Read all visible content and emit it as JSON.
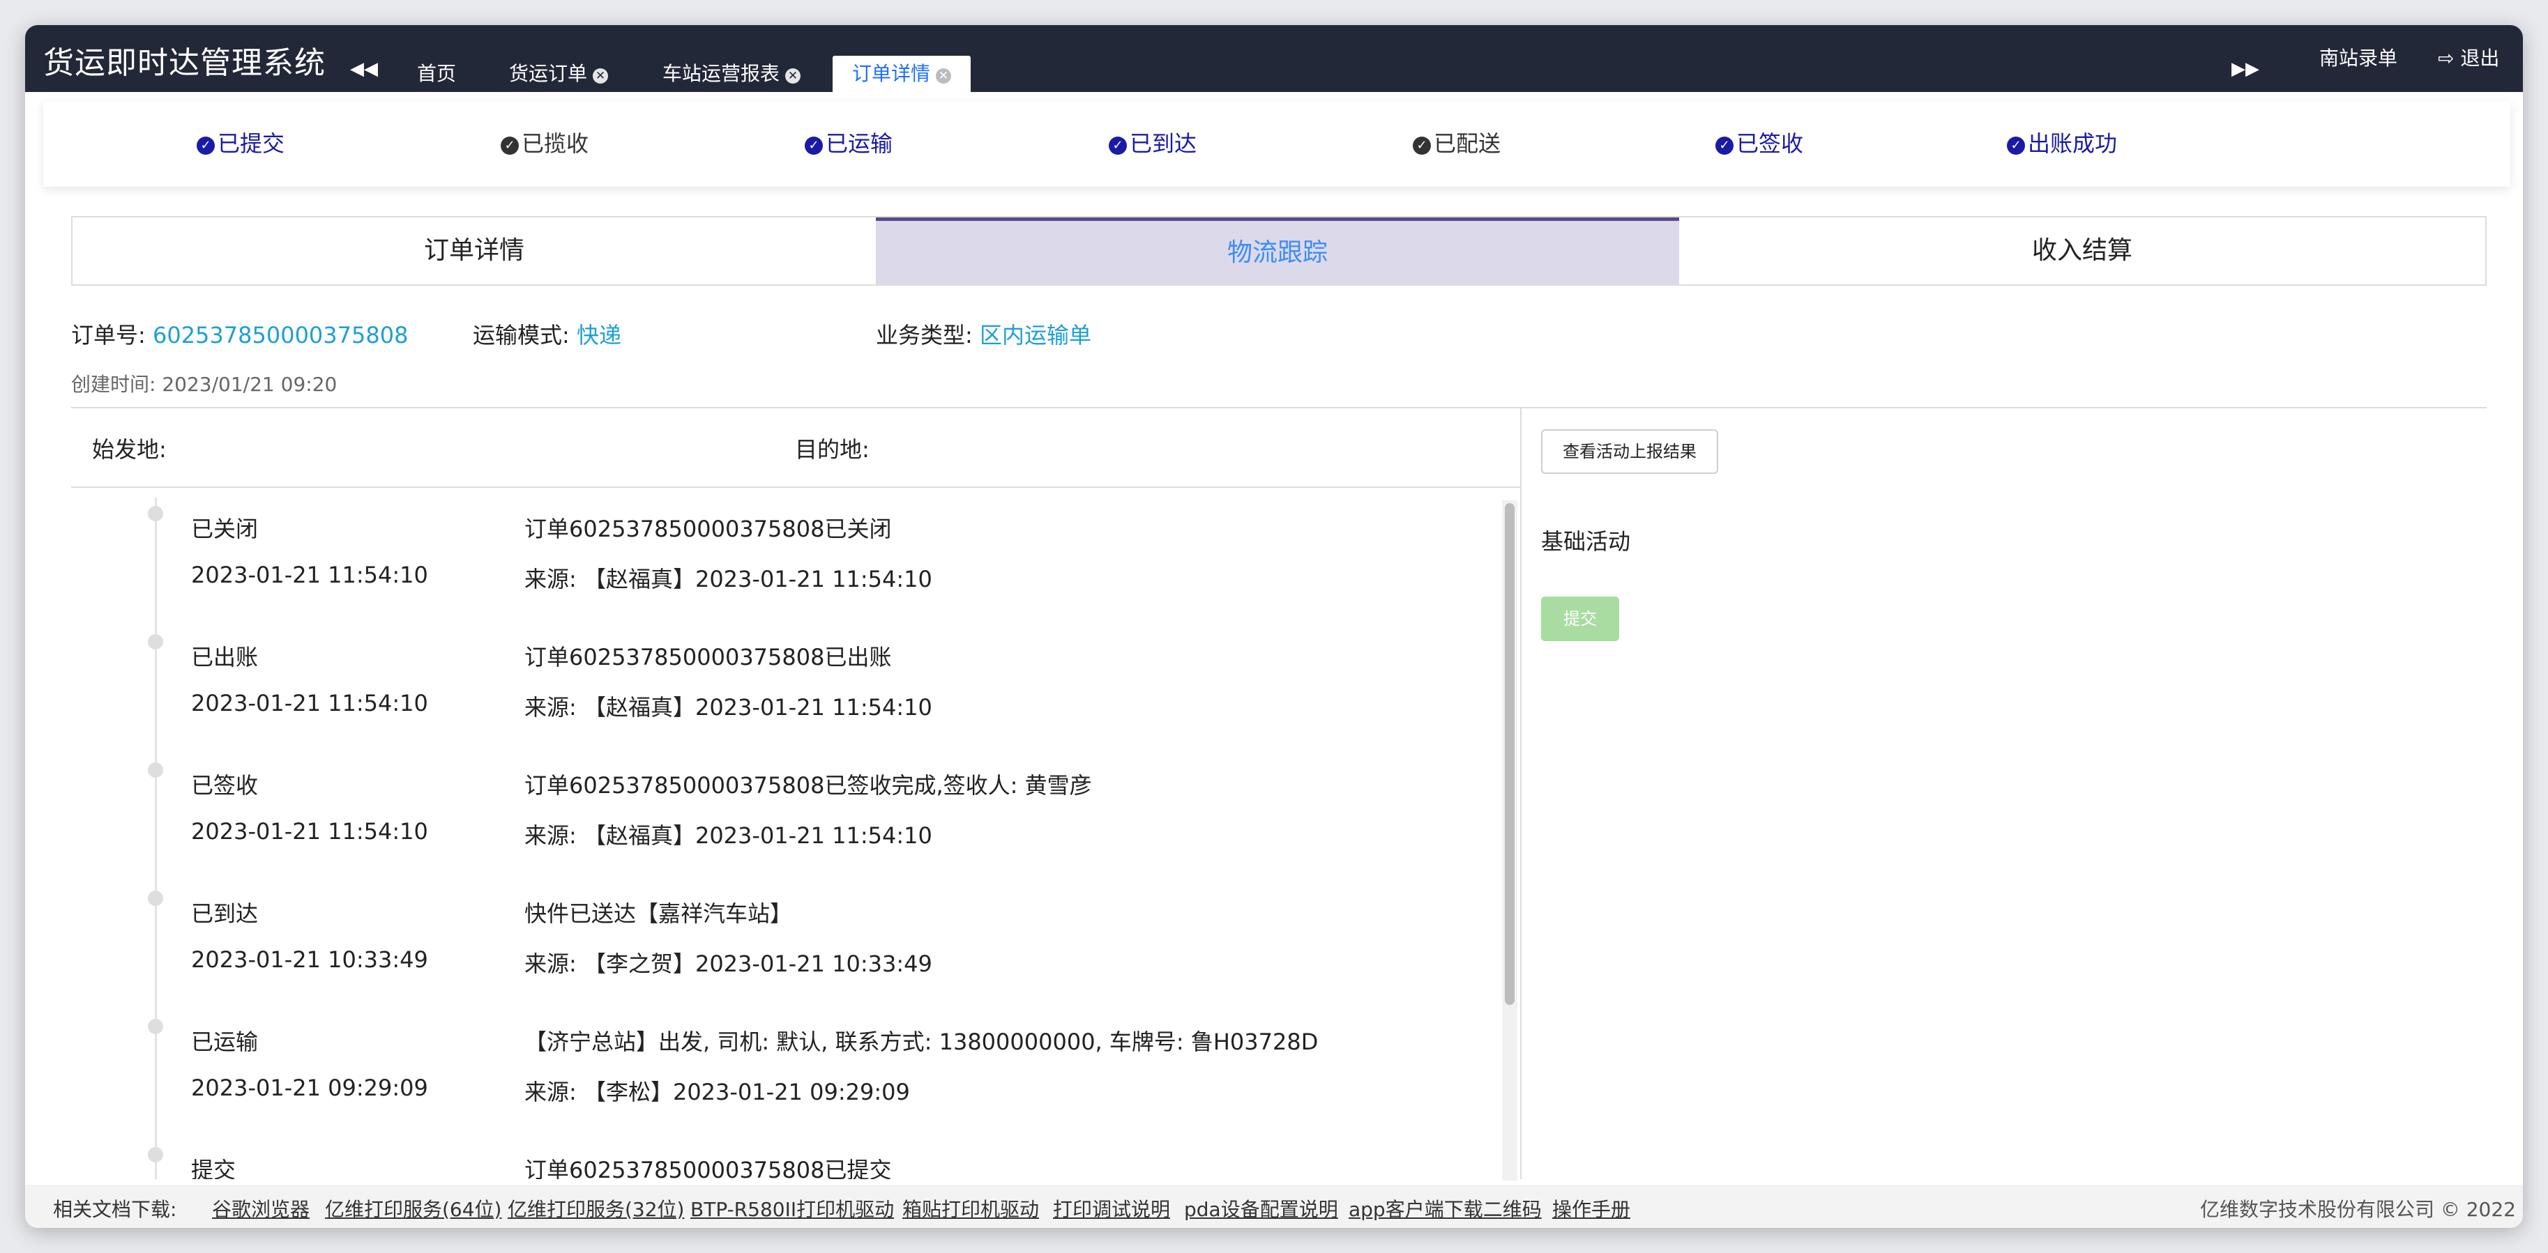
{
  "app": {
    "title": "货运即时达管理系统"
  },
  "nav": {
    "tabs": [
      {
        "label": "首页"
      },
      {
        "label": "货运订单"
      },
      {
        "label": "车站运营报表"
      },
      {
        "label": "订单详情"
      }
    ],
    "station": "南站录单",
    "logout": "退出"
  },
  "statuses": [
    {
      "label": "已提交",
      "state": "done"
    },
    {
      "label": "已揽收",
      "state": "pending"
    },
    {
      "label": "已运输",
      "state": "done"
    },
    {
      "label": "已到达",
      "state": "done"
    },
    {
      "label": "已配送",
      "state": "pending"
    },
    {
      "label": "已签收",
      "state": "done"
    },
    {
      "label": "出账成功",
      "state": "done"
    }
  ],
  "main_tabs": [
    {
      "label": "订单详情"
    },
    {
      "label": "物流跟踪"
    },
    {
      "label": "收入结算"
    }
  ],
  "order": {
    "no_label": "订单号:",
    "no": "602537850000375808",
    "mode_label": "运输模式:",
    "mode": "快递",
    "type_label": "业务类型:",
    "type": "区内运输单",
    "created_label": "创建时间: ",
    "created": "2023/01/21 09:20"
  },
  "route": {
    "origin_label": "始发地:",
    "dest_label": "目的地:"
  },
  "timeline": [
    {
      "status": "已关闭",
      "time": "2023-01-21 11:54:10",
      "desc": "订单602537850000375808已关闭",
      "source": "来源: 【赵福真】2023-01-21 11:54:10"
    },
    {
      "status": "已出账",
      "time": "2023-01-21 11:54:10",
      "desc": "订单602537850000375808已出账",
      "source": "来源: 【赵福真】2023-01-21 11:54:10"
    },
    {
      "status": "已签收",
      "time": "2023-01-21 11:54:10",
      "desc": "订单602537850000375808已签收完成,签收人: 黄雪彦",
      "source": "来源: 【赵福真】2023-01-21 11:54:10"
    },
    {
      "status": "已到达",
      "time": "2023-01-21 10:33:49",
      "desc": "快件已送达【嘉祥汽车站】",
      "source": "来源: 【李之贺】2023-01-21 10:33:49"
    },
    {
      "status": "已运输",
      "time": "2023-01-21 09:29:09",
      "desc": "【济宁总站】出发, 司机: 默认, 联系方式: 13800000000, 车牌号: 鲁H03728D",
      "source": "来源: 【李松】2023-01-21 09:29:09"
    },
    {
      "status": "提交",
      "time": "",
      "desc": "订单602537850000375808已提交",
      "source": ""
    }
  ],
  "right_panel": {
    "report_button": "查看活动上报结果",
    "section_title": "基础活动",
    "submit_button": "提交"
  },
  "footer": {
    "label": "相关文档下载:",
    "links": [
      "谷歌浏览器",
      "亿维打印服务(64位)",
      "亿维打印服务(32位)",
      "BTP-R580II打印机驱动",
      "箱贴打印机驱动",
      "打印调试说明",
      "pda设备配置说明",
      "app客户端下载二维码",
      "操作手册"
    ],
    "copyright": "亿维数字技术股份有限公司 © 2022"
  },
  "colors": {
    "topbar": "#232838",
    "done": "#1a1aa6",
    "link": "#1e9fd6",
    "active_tab_bg": "#dcdaea",
    "submit": "#a8dca0"
  },
  "icons": [
    "double-left-icon",
    "double-right-icon",
    "close-circle-icon",
    "logout-icon",
    "check-circle-icon"
  ]
}
